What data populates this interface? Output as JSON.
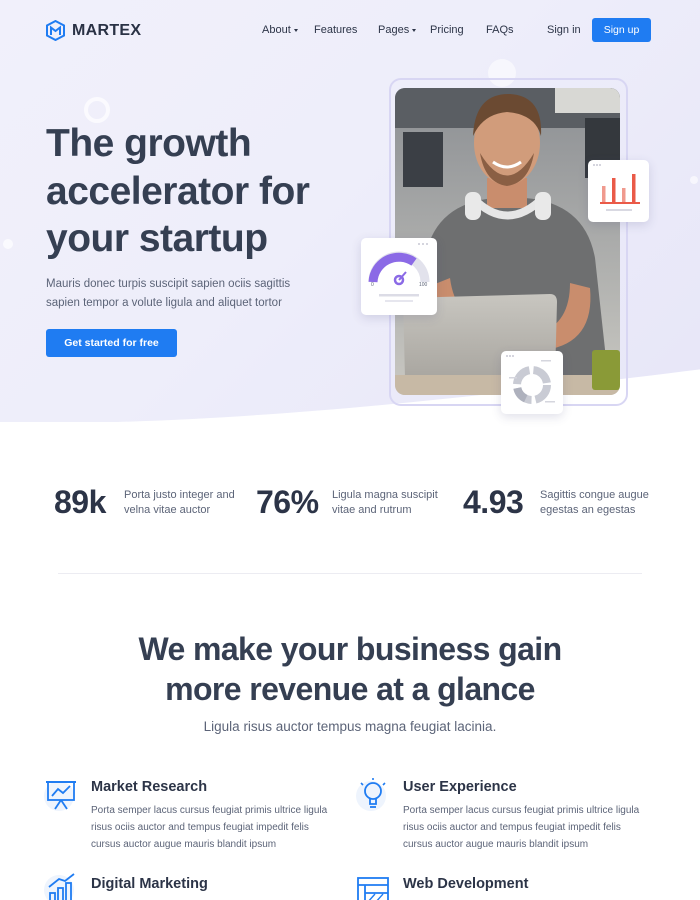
{
  "brand": {
    "name": "MARTEX",
    "accent": "#1f7cf2",
    "logo_icon": "martex-logo-icon"
  },
  "nav": {
    "items": [
      {
        "label": "About",
        "has_dropdown": true
      },
      {
        "label": "Features",
        "has_dropdown": false
      },
      {
        "label": "Pages",
        "has_dropdown": true
      },
      {
        "label": "Pricing",
        "has_dropdown": false
      },
      {
        "label": "FAQs",
        "has_dropdown": false
      }
    ],
    "signin": "Sign in",
    "signup": "Sign up"
  },
  "hero": {
    "title": "The growth accelerator for your startup",
    "description": "Mauris donec turpis suscipit sapien ociis sagittis sapien tempor a volute ligula and aliquet tortor",
    "cta": "Get started for free",
    "gauge": {
      "min": "0",
      "max": "100",
      "level": 0.72
    }
  },
  "stats": [
    {
      "value": "89k",
      "text": "Porta justo integer and velna vitae auctor"
    },
    {
      "value": "76%",
      "text": "Ligula magna suscipit vitae and rutrum"
    },
    {
      "value": "4.93",
      "text": "Sagittis congue augue egestas an egestas"
    }
  ],
  "section": {
    "title_line1": "We make your business gain",
    "title_line2": "more revenue at a glance",
    "subtitle": "Ligula risus auctor tempus magna feugiat lacinia."
  },
  "features": [
    {
      "title": "Market Research",
      "icon": "presentation-chart-icon",
      "text": "Porta semper lacus cursus feugiat primis ultrice ligula risus ociis auctor and tempus feugiat impedit felis cursus auctor augue mauris blandit ipsum"
    },
    {
      "title": "User Experience",
      "icon": "lightbulb-icon",
      "text": "Porta semper lacus cursus feugiat primis ultrice ligula risus ociis auctor and tempus feugiat impedit felis cursus auctor augue mauris blandit ipsum"
    },
    {
      "title": "Digital Marketing",
      "icon": "growth-chart-icon",
      "text": ""
    },
    {
      "title": "Web Development",
      "icon": "web-layout-icon",
      "text": ""
    }
  ]
}
